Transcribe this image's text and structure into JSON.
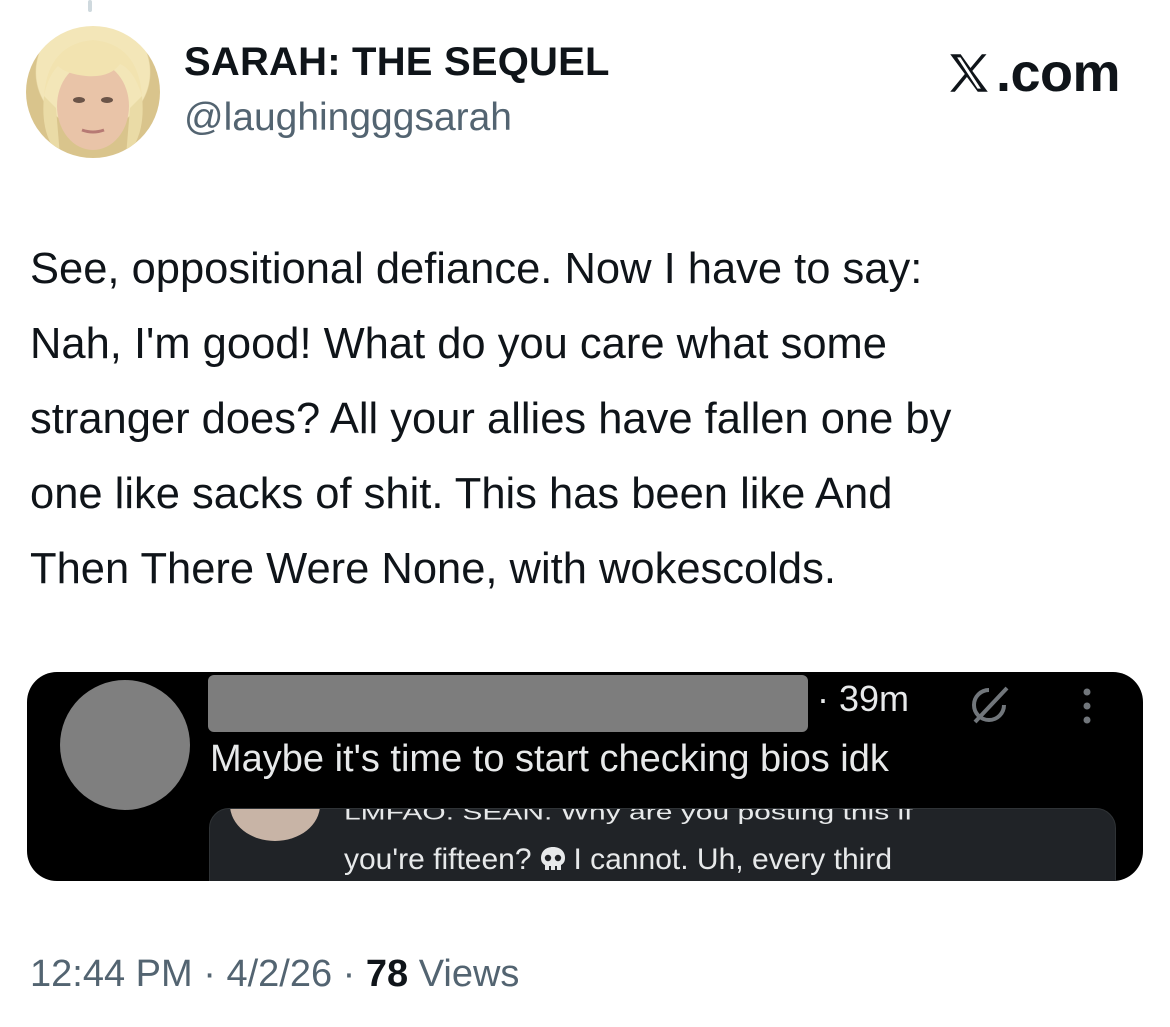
{
  "author": {
    "display_name": "SARAH: THE SEQUEL",
    "handle": "@laughingggsarah"
  },
  "brand": {
    "logo_icon": "x-logo-icon",
    "text": ".com"
  },
  "tweet": {
    "lines": [
      "See, oppositional defiance. Now I have to say:",
      "Nah, I'm good! What do you care what some",
      "stranger does? All your allies have fallen one by",
      "one like sacks of shit. This has been like And",
      "Then There Were None, with wokescolds."
    ]
  },
  "embedded_post": {
    "name": "",
    "time": "· 39m",
    "reply_text": "Maybe it's time to start checking bios idk",
    "quote_line1": "LMFAO. SEAN. Why are you posting this if",
    "quote_line2_before": "you're fifteen?",
    "quote_line2_after": "I cannot. Uh, every third",
    "icons": [
      "grok-icon",
      "more-icon",
      "skull-icon"
    ]
  },
  "meta": {
    "time": "12:44 PM",
    "sep1": " · ",
    "date": "4/2/26",
    "sep2": " · ",
    "views_count": "78",
    "views_label": " Views"
  }
}
